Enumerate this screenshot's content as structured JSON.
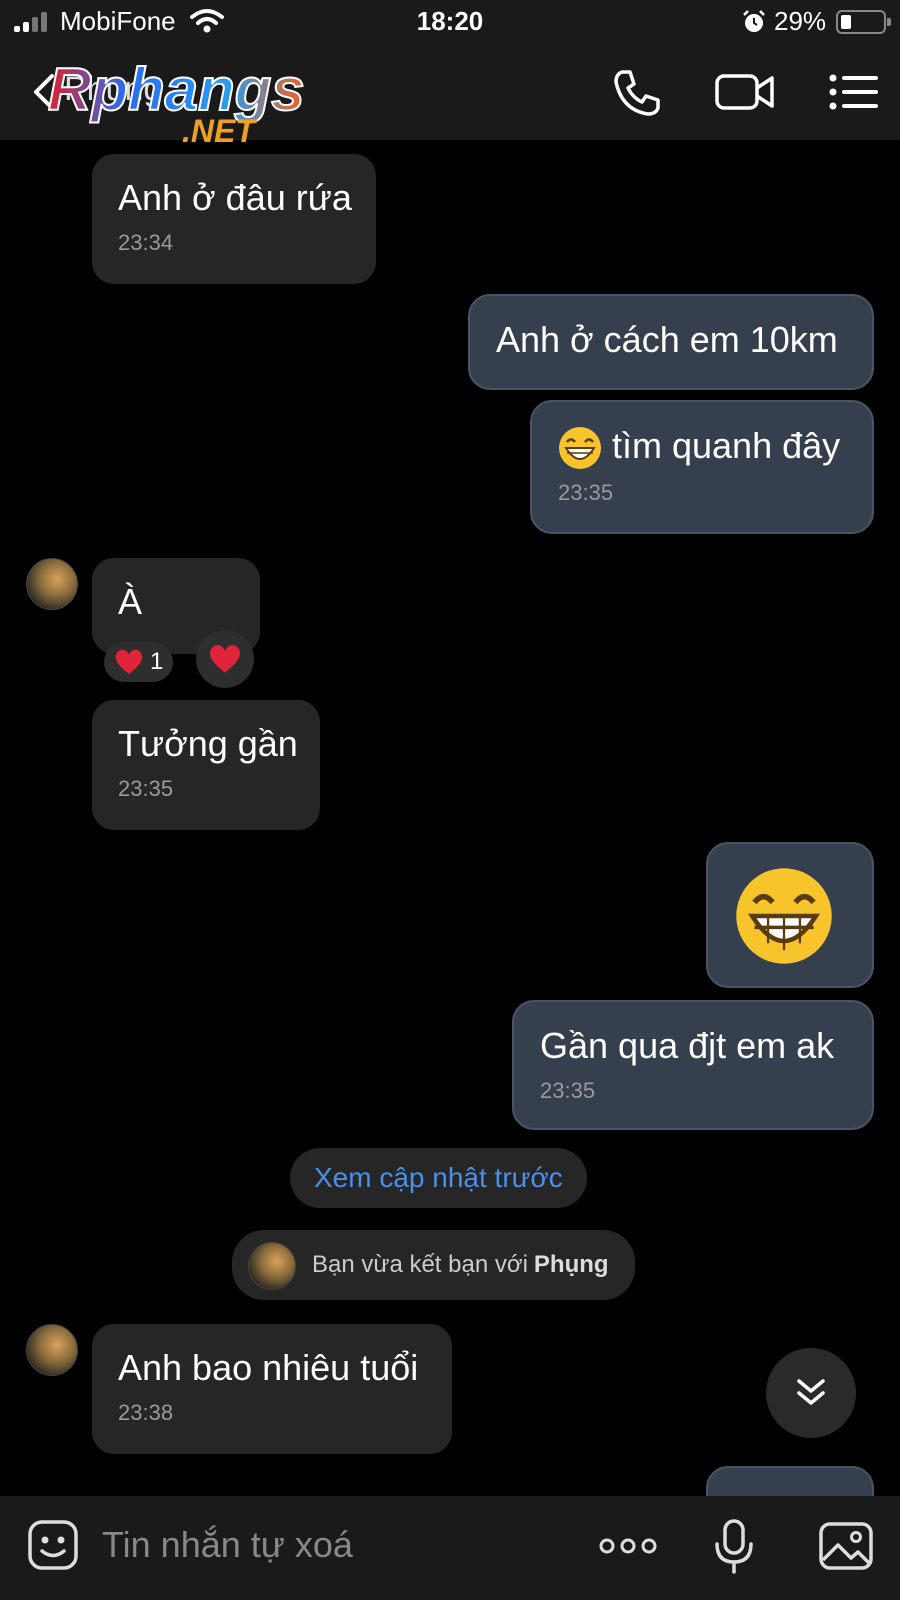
{
  "status_bar": {
    "carrier": "MobiFone",
    "time": "18:20",
    "battery": "29%"
  },
  "header": {
    "contact_name": "Phụng",
    "watermark_main": "Rphangs",
    "watermark_sub": ".NET"
  },
  "messages": [
    {
      "dir": "in",
      "text": "Anh ở đâu rứa",
      "time": "23:34"
    },
    {
      "dir": "out",
      "text": "Anh ở cách em 10km"
    },
    {
      "dir": "out",
      "emoji": "grinning-face",
      "text": "tìm quanh đây",
      "time": "23:35"
    },
    {
      "dir": "in",
      "text": "À",
      "reaction": {
        "emoji": "red-heart",
        "count": "1"
      }
    },
    {
      "dir": "in",
      "text": "Tưởng gần",
      "time": "23:35"
    },
    {
      "dir": "out",
      "sticker": "grinning-face-large"
    },
    {
      "dir": "out",
      "text": "Gần qua đjt em ak",
      "time": "23:35"
    },
    {
      "dir": "in",
      "text": "Anh bao nhiêu tuổi",
      "time": "23:38"
    }
  ],
  "system": {
    "view_previous": "Xem cập nhật trước",
    "friend_notice": "Bạn vừa kết bạn với",
    "friend_name": "Phụng"
  },
  "input": {
    "placeholder": "Tin nhắn tự xoá"
  },
  "icons": {
    "back": "chevron-left-icon",
    "call": "phone-icon",
    "video": "video-camera-icon",
    "menu": "list-menu-icon",
    "sticker": "sticker-icon",
    "more": "more-dots-icon",
    "mic": "microphone-icon",
    "image": "image-icon",
    "scroll": "double-chevron-down-icon"
  },
  "colors": {
    "incoming_bubble": "#262626",
    "outgoing_bubble": "#363f4d",
    "link_blue": "#4a8fe8",
    "heart": "#e0243a"
  }
}
